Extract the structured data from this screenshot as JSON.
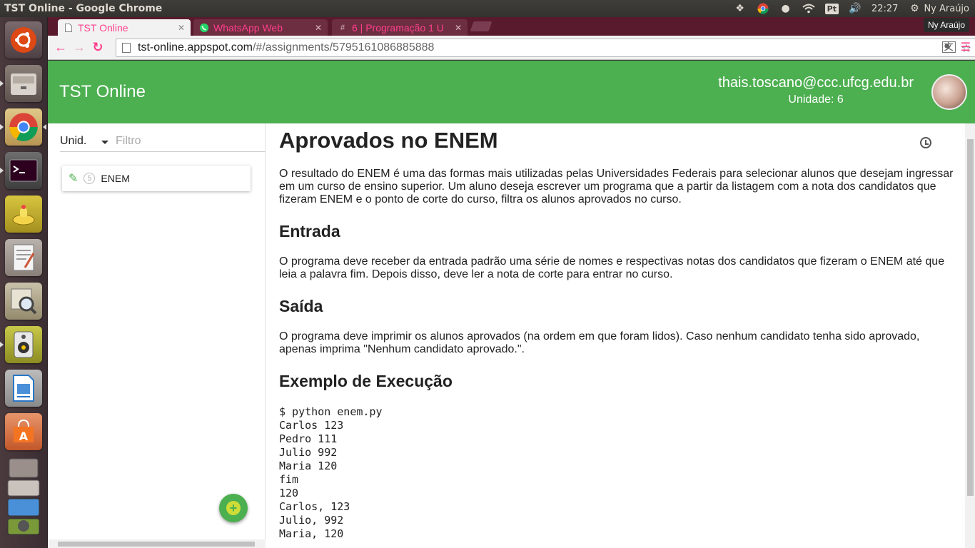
{
  "window": {
    "title": "TST Online - Google Chrome"
  },
  "tray": {
    "input_method": "Pt",
    "clock": "22:27",
    "user": "Ny Araújo"
  },
  "launcher": {
    "items": [
      "ubuntu-dash",
      "files",
      "chrome",
      "terminal",
      "genie",
      "text-editor",
      "image-viewer",
      "speaker",
      "writer",
      "software-center",
      "trash-stack"
    ]
  },
  "tabs": [
    {
      "label": "TST Online",
      "active": true
    },
    {
      "label": "WhatsApp Web",
      "active": false
    },
    {
      "label": "6 | Programação 1 U",
      "active": false
    }
  ],
  "profile_badge": "Ny Araújo",
  "address": {
    "host": "tst-online.appspot.com",
    "path": "/#/assignments/5795161086885888"
  },
  "app": {
    "brand": "TST Online",
    "user_email": "thais.toscano@ccc.ufcg.edu.br",
    "user_unit": "Unidade: 6"
  },
  "sidebar": {
    "unit_select": "Unid.",
    "filter_placeholder": "Filtro",
    "assignments": [
      {
        "badge": "5",
        "label": "ENEM"
      }
    ]
  },
  "assignment": {
    "title": "Aprovados no ENEM",
    "intro": "O resultado do ENEM é uma das formas mais utilizadas pelas Universidades Federais para selecionar alunos que desejam ingressar em um curso de ensino superior. Um aluno deseja escrever um programa que a partir da listagem com a nota dos candidatos que fizeram ENEM e o ponto de corte do curso, filtra os alunos aprovados no curso.",
    "input_heading": "Entrada",
    "input_text": "O programa deve receber da entrada padrão uma série de nomes e respectivas notas dos candidatos que fizeram o ENEM até que leia a palavra fim. Depois disso, deve ler a nota de corte para entrar no curso.",
    "output_heading": "Saída",
    "output_text": "O programa deve imprimir os alunos aprovados (na ordem em que foram lidos). Caso nenhum candidato tenha sido aprovado, apenas imprima \"Nenhum candidato aprovado.\".",
    "example_heading": "Exemplo de Execução",
    "example": "$ python enem.py\nCarlos 123\nPedro 111\nJulio 992\nMaria 120\nfim\n120\nCarlos, 123\nJulio, 992\nMaria, 120"
  }
}
